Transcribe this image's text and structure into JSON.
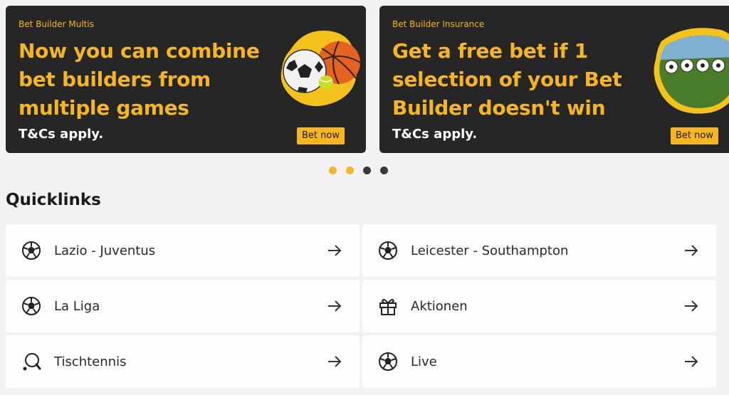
{
  "carousel": {
    "banners": [
      {
        "kicker": "Bet Builder Multis",
        "headline": "Now you can combine bet builders from multiple games",
        "tcs": "T&Cs apply.",
        "cta": "Bet now",
        "art": "sports-balls-icon"
      },
      {
        "kicker": "Bet Builder Insurance",
        "headline": "Get a free bet if 1 selection of your Bet Builder doesn't win",
        "tcs": "T&Cs apply.",
        "cta": "Bet now",
        "art": "stadium-footballs-icon"
      }
    ],
    "dots": [
      true,
      true,
      false,
      false
    ]
  },
  "quicklinks": {
    "title": "Quicklinks",
    "items": [
      {
        "label": "Lazio - Juventus",
        "icon": "football-icon"
      },
      {
        "label": "Leicester - Southampton",
        "icon": "football-icon"
      },
      {
        "label": "La Liga",
        "icon": "football-icon"
      },
      {
        "label": "Aktionen",
        "icon": "gift-icon"
      },
      {
        "label": "Tischtennis",
        "icon": "table-tennis-icon"
      },
      {
        "label": "Live",
        "icon": "football-icon"
      }
    ]
  },
  "colors": {
    "accent": "#f6b71c",
    "banner_bg": "#262626",
    "page_bg": "#f2f2f4"
  }
}
